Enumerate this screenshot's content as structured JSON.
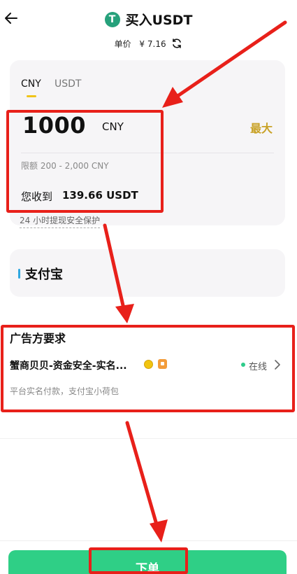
{
  "header": {
    "title": "买入USDT",
    "coin_symbol": "T",
    "price_label": "单价",
    "price_value": "¥ 7.16"
  },
  "amount_card": {
    "tabs": [
      {
        "label": "CNY",
        "active": true
      },
      {
        "label": "USDT",
        "active": false
      }
    ],
    "amount_value": "1000",
    "amount_currency": "CNY",
    "max_label": "最大",
    "limit_text": "限额 200 - 2,000 CNY",
    "receive_label": "您收到",
    "receive_value": "139.66 USDT"
  },
  "protection_text": "24 小时提现安全保护",
  "payment": {
    "method_label": "支付宝"
  },
  "advertiser": {
    "section_title": "广告方要求",
    "merchant_name": "蟹商贝贝-资金安全-实名...",
    "status": "在线",
    "requirements": "平台实名付款，支付宝小荷包"
  },
  "footer": {
    "submit_label": "下单"
  },
  "colors": {
    "accent_gold": "#c9a227",
    "submit_green": "#2fcf86",
    "annotation_red": "#e8201a",
    "tether_green": "#26a17b"
  },
  "icons": [
    "back-arrow-icon",
    "tether-icon",
    "refresh-icon",
    "chevron-right-icon",
    "verified-badge-icon",
    "merchant-badge-icon"
  ]
}
